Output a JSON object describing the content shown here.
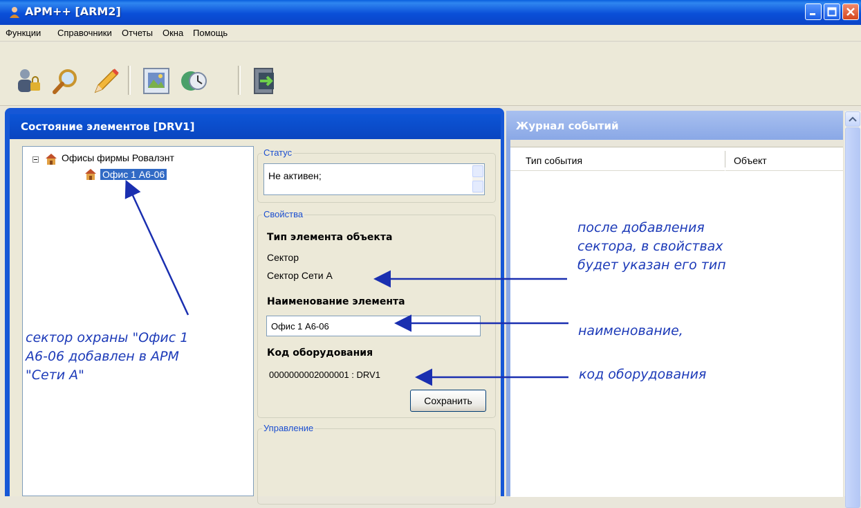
{
  "window": {
    "title": "АРМ++ [ARM2]"
  },
  "menu": [
    {
      "label": "Функции"
    },
    {
      "label": "Справочники"
    },
    {
      "label": "Отчеты"
    },
    {
      "label": "Окна"
    },
    {
      "label": "Помощь"
    }
  ],
  "toolbar": {
    "icons": [
      "users-lock-icon",
      "search-icon",
      "pencil-icon",
      "gallery-icon",
      "globe-clock-icon",
      "exit-icon"
    ]
  },
  "left_panel": {
    "title": "Состояние элементов [DRV1]",
    "tree": {
      "root": "Офисы фирмы Ровалэнт",
      "child": "Офис 1 А6-06"
    },
    "status": {
      "title": "Статус",
      "value": "Не активен;"
    },
    "properties": {
      "title": "Свойства",
      "type_label": "Тип элемента объекта",
      "type_value_1": "Сектор",
      "type_value_2": "Сектор Сети А",
      "name_label": "Наименование элемента",
      "name_value": "Офис 1 А6-06",
      "code_label": "Код оборудования",
      "code_value": "0000000002000001 : DRV1",
      "save_label": "Сохранить"
    },
    "control": {
      "title": "Управление"
    }
  },
  "right_panel": {
    "title": "Журнал событий",
    "columns": [
      "Тип события",
      "Объект"
    ]
  },
  "annotations": {
    "sector_note": [
      "сектор охраны \"Офис 1",
      "А6-06 добавлен в АРМ",
      "\"Сети А\""
    ],
    "type_note": [
      "после добавления",
      "сектора, в свойствах",
      "будет указан его тип"
    ],
    "name_note": "наименование,",
    "code_note": "код оборудования"
  },
  "colors": {
    "titlebar": "#0a4fd8",
    "panel_header": "#0c55d6",
    "journal_header": "#8aa8e6",
    "annotation": "#1c3ab8",
    "selection": "#316ac5"
  }
}
